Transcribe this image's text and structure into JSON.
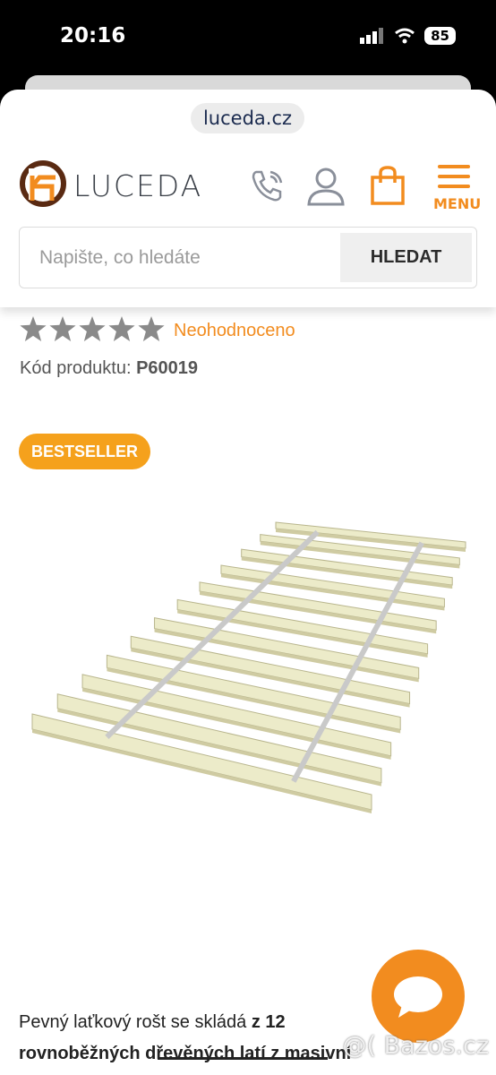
{
  "status": {
    "time": "20:16",
    "battery": "85"
  },
  "browser": {
    "url": "luceda.cz"
  },
  "header": {
    "logo_text": "LUCEDA",
    "menu_label": "MENU"
  },
  "search": {
    "placeholder": "Napište, co hledáte",
    "button_label": "HLEDAT"
  },
  "product": {
    "rating_text": "Neohodnoceno",
    "stars_filled": 0,
    "stars_total": 5,
    "code_label": "Kód produktu:",
    "code_value": "P60019",
    "badge": "BESTSELLER",
    "slat_count": 12
  },
  "description": {
    "line1_normal": "Pevný laťkový rošt se skládá ",
    "line1_bold": "z 12",
    "line2_bold": "rovnoběžných dřevěných latí z masivní"
  },
  "watermark": "@( Bazos.cz",
  "colors": {
    "accent": "#f28c1f",
    "badge": "#f5a11c",
    "star": "#8a8a8a"
  }
}
